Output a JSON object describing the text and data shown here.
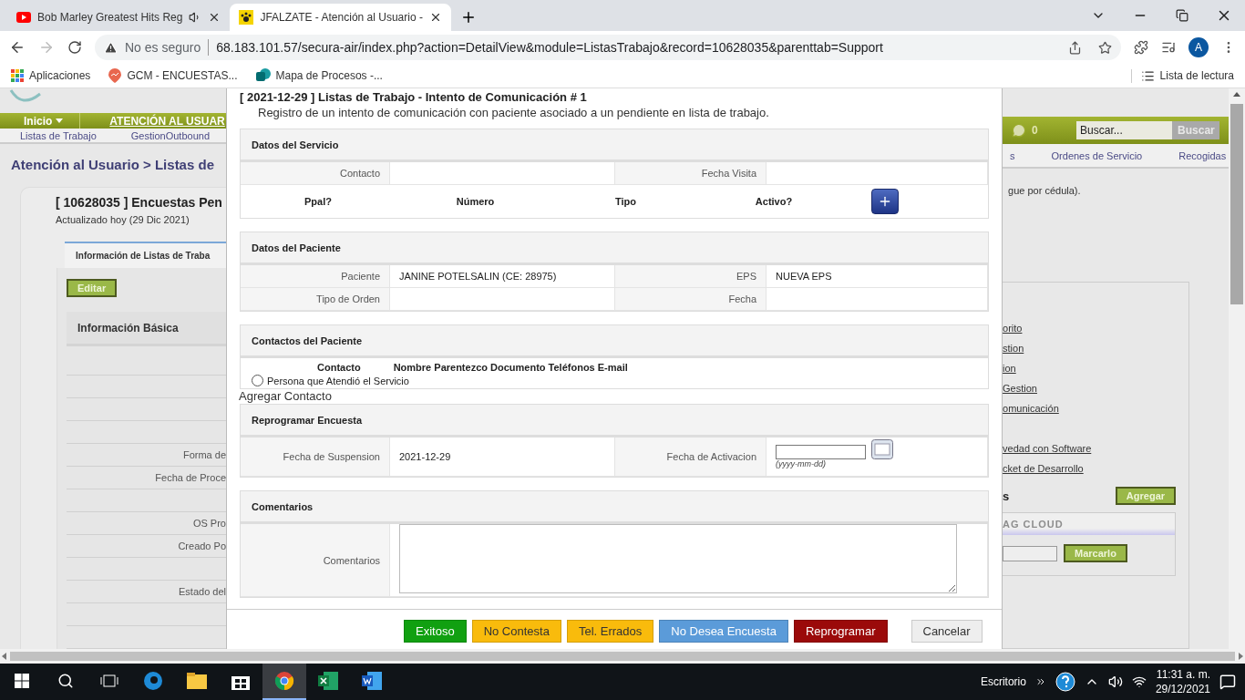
{
  "browser": {
    "tabs": [
      {
        "title": "Bob Marley Greatest Hits Reg",
        "kind": "video",
        "audio": true,
        "selected": false
      },
      {
        "title": "JFALZATE - Atención al Usuario -",
        "kind": "paw",
        "audio": false,
        "selected": true
      }
    ],
    "forward_disabled": true,
    "security": "No es seguro",
    "url": "68.183.101.57/secura-air/index.php?action=DetailView&module=ListasTrabajo&record=10628035&parenttab=Support",
    "profile": "A",
    "bookmarks": [
      {
        "label": "Aplicaciones",
        "kind": "apps"
      },
      {
        "label": "GCM - ENCUESTAS...",
        "kind": "pin"
      },
      {
        "label": "Mapa de Procesos -...",
        "kind": "doc"
      }
    ],
    "reading_list": "Lista de lectura"
  },
  "page_left": {
    "menu": "Inicio",
    "module": "ATENCIÓN AL USUAR",
    "subnav": [
      "Listas de Trabajo",
      "GestionOutbound"
    ],
    "breadcrumb": "Atención al Usuario > Listas de",
    "record_title": "[ 10628035 ] Encuestas Pen",
    "updated": "Actualizado hoy (29 Dic 2021)",
    "tab": {
      "label": "Información de Listas de Traba",
      "selected": true
    },
    "edit_button": "Editar",
    "block_title": "Información Básica",
    "rows": [
      null,
      null,
      null,
      "Forma de",
      "Fecha de Proce",
      null,
      "OS Pro",
      "Creado Po",
      null,
      "Estado del",
      null,
      null
    ]
  },
  "page_right": {
    "chat_count": "0",
    "search_placeholder": "Buscar...",
    "search_button": "Buscar",
    "subnav": [
      "s",
      "Ordenes de Servicio",
      "Recogidas"
    ],
    "note": "gue por cédula).",
    "links": [
      "orito",
      "stion",
      "ion",
      "Gestion",
      "omunicación",
      "vedad con Software",
      "cket de Desarrollo"
    ],
    "tags_heading": "s",
    "add_button": "Agregar",
    "tag_cloud": "AG CLOUD",
    "mark_button": "Marcarlo"
  },
  "dialog": {
    "title": "[ 2021-12-29 ] Listas de Trabajo - Intento de Comunicación # 1",
    "subtitle": "Registro de un intento de comunicación con paciente asociado a un pendiente en lista de trabajo.",
    "service": {
      "title": "Datos del Servicio",
      "contact_label": "Contacto",
      "visit_label": "Fecha Visita",
      "phone_columns": [
        "Ppal?",
        "Número",
        "Tipo",
        "Activo?"
      ]
    },
    "patient": {
      "title": "Datos del Paciente",
      "fields": [
        {
          "label": "Paciente",
          "value": "JANINE POTELSALIN (CE: 28975)"
        },
        {
          "label": "EPS",
          "value": "NUEVA EPS"
        },
        {
          "label": "Tipo de Orden"
        },
        {
          "label": "Fecha"
        }
      ]
    },
    "contacts": {
      "title": "Contactos del Paciente",
      "contact_label": "Contacto",
      "columns": "Nombre Parentezco Documento Teléfonos E-mail",
      "option": {
        "label": "Persona que Atendió el Servicio",
        "checked": false
      }
    },
    "add_contact": "Agregar Contacto",
    "reschedule": {
      "title": "Reprogramar Encuesta",
      "suspension_label": "Fecha de Suspension",
      "suspension": "2021-12-29",
      "activation_label": "Fecha de Activacion",
      "date_hint": "(yyyy-mm-dd)"
    },
    "comments": {
      "title": "Comentarios",
      "label": "Comentarios"
    },
    "actions": [
      {
        "label": "Exitoso",
        "color": "#11a011"
      },
      {
        "label": "No Contesta",
        "color": "#f9bb0c"
      },
      {
        "label": "Tel. Errados",
        "color": "#f9bb0c"
      },
      {
        "label": "No Desea Encuesta",
        "color": "#5b9bd9"
      },
      {
        "label": "Reprogramar",
        "color": "#9b0a0a"
      },
      {
        "label": "Cancelar",
        "color": "#eeeeee"
      }
    ]
  },
  "taskbar": {
    "apps": [
      {
        "kind": "edge",
        "selected": false
      },
      {
        "kind": "folder",
        "selected": false
      },
      {
        "kind": "store",
        "selected": false
      },
      {
        "kind": "chrome",
        "selected": true
      },
      {
        "kind": "excel",
        "selected": false
      },
      {
        "kind": "word",
        "selected": false
      }
    ],
    "desktop": "Escritorio",
    "time": "11:31 a. m.",
    "date": "29/12/2021"
  }
}
